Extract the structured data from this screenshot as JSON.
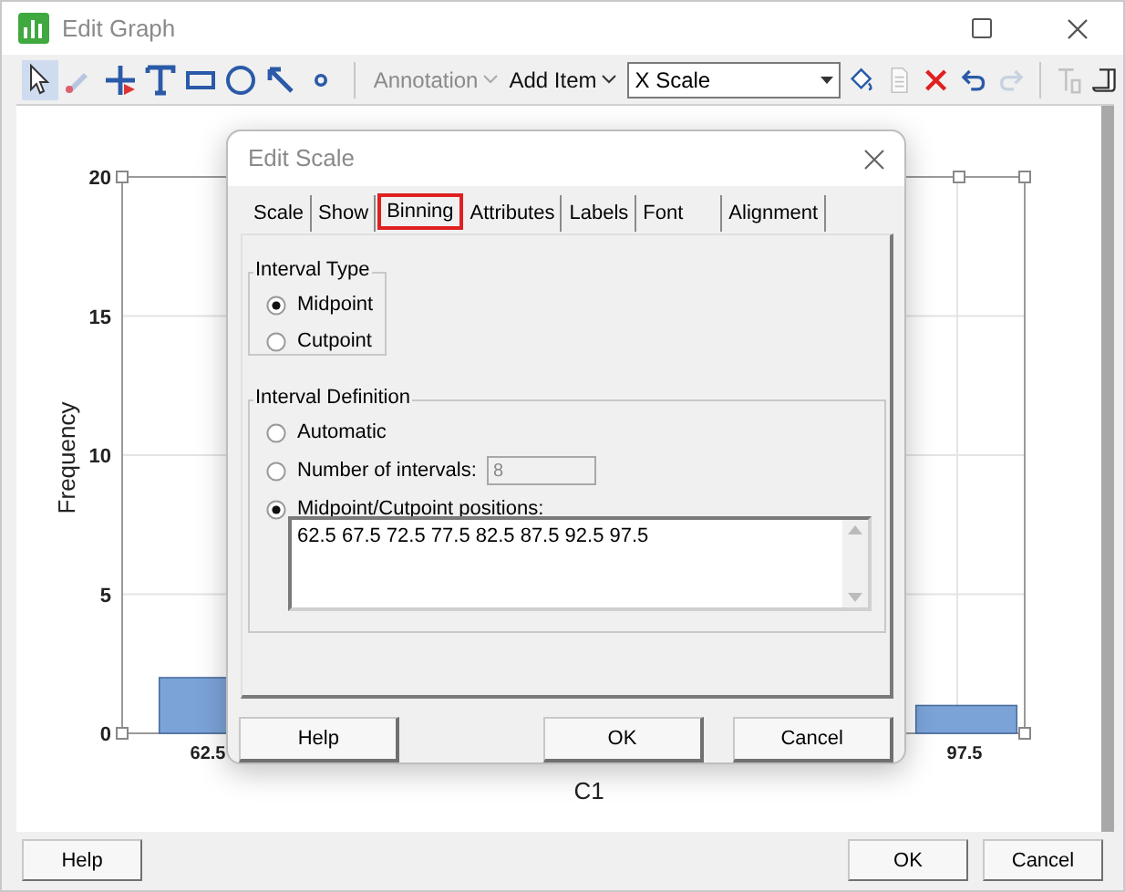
{
  "window": {
    "title": "Edit Graph"
  },
  "toolbar": {
    "tools": [
      {
        "kind": "pointer",
        "selected": true
      },
      {
        "kind": "pen",
        "selected": false
      },
      {
        "kind": "crosshair",
        "selected": false
      },
      {
        "kind": "text",
        "selected": false
      },
      {
        "kind": "rectangle",
        "selected": false
      },
      {
        "kind": "ellipse",
        "selected": false
      },
      {
        "kind": "arrow",
        "selected": false
      },
      {
        "kind": "dot",
        "selected": false
      }
    ],
    "menus": [
      {
        "label": "Annotation",
        "disabled": true
      },
      {
        "label": "Add Item",
        "disabled": false
      }
    ],
    "item_select": {
      "value": "X Scale"
    },
    "actions": [
      {
        "kind": "fill",
        "disabled": false
      },
      {
        "kind": "document",
        "disabled": true
      },
      {
        "kind": "delete",
        "disabled": false
      },
      {
        "kind": "undo",
        "disabled": false
      },
      {
        "kind": "redo",
        "disabled": true
      },
      {
        "kind": "font",
        "disabled": true
      },
      {
        "kind": "scroll",
        "disabled": false
      }
    ]
  },
  "graph": {
    "chart_data": {
      "type": "bar",
      "xlabel": "C1",
      "ylabel": "Frequency",
      "categories": [
        "62.5",
        "97.5"
      ],
      "values": [
        2,
        1
      ],
      "ylim": [
        0,
        20
      ],
      "yticks": [
        0,
        5,
        10,
        15,
        20
      ]
    }
  },
  "dialog": {
    "title": "Edit Scale",
    "tabs": [
      {
        "label": "Scale",
        "selected": false
      },
      {
        "label": "Show",
        "selected": false
      },
      {
        "label": "Binning",
        "selected": true
      },
      {
        "label": "Attributes",
        "selected": false
      },
      {
        "label": "Labels",
        "selected": false
      },
      {
        "label": "Font",
        "selected": false
      },
      {
        "label": "Alignment",
        "selected": false
      }
    ],
    "interval_type": {
      "title": "Interval Type",
      "options": [
        {
          "label": "Midpoint",
          "selected": true
        },
        {
          "label": "Cutpoint",
          "selected": false
        }
      ]
    },
    "interval_definition": {
      "title": "Interval Definition",
      "options": [
        {
          "label": "Automatic",
          "selected": false
        },
        {
          "label": "Number of intervals:",
          "selected": false
        },
        {
          "label": "Midpoint/Cutpoint positions:",
          "selected": true
        }
      ],
      "number_of_intervals": {
        "value": "8",
        "disabled": true
      },
      "positions": {
        "value": "62.5 67.5 72.5 77.5 82.5 87.5 92.5 97.5"
      }
    },
    "buttons": [
      "Help",
      "OK",
      "Cancel"
    ]
  },
  "buttons": [
    "Help",
    "OK",
    "Cancel"
  ]
}
